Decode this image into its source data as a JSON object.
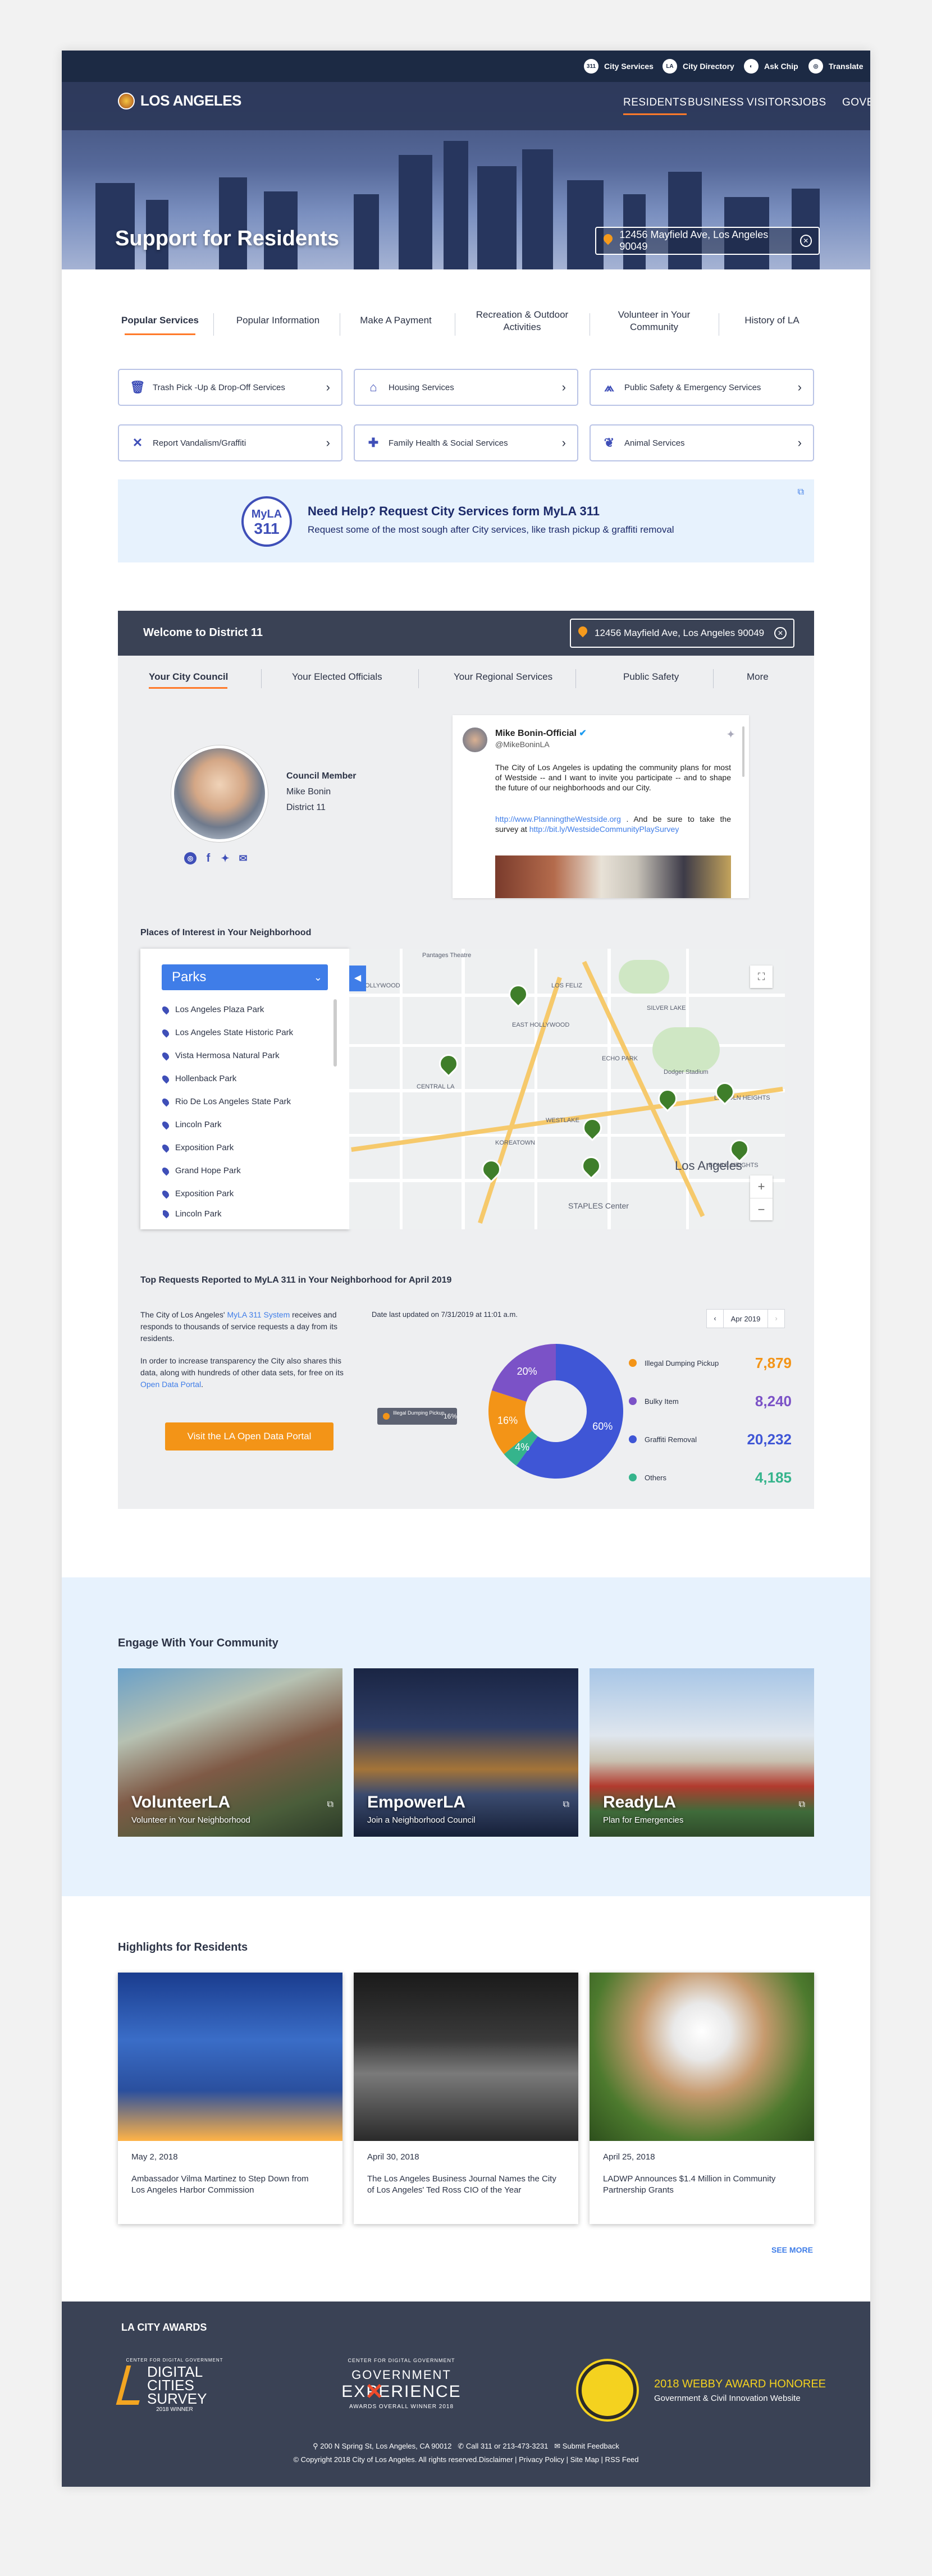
{
  "utility": {
    "items": [
      {
        "label": "City Services",
        "icon": "311"
      },
      {
        "label": "City Directory",
        "icon": "LA"
      },
      {
        "label": "Ask Chip",
        "icon": "chip"
      },
      {
        "label": "Translate",
        "icon": "globe"
      }
    ]
  },
  "brand": {
    "name": "LOS ANGELES"
  },
  "nav": {
    "items": [
      "RESIDENTS",
      "BUSINESS",
      "VISITORS",
      "JOBS",
      "GOVERNMENT"
    ],
    "active": "RESIDENTS"
  },
  "hero": {
    "title": "Support for Residents",
    "address": "12456 Mayfield Ave, Los Angeles 90049"
  },
  "tabs": [
    {
      "label": "Popular Services"
    },
    {
      "label": "Popular Information"
    },
    {
      "label": "Make A Payment"
    },
    {
      "label": "Recreation & Outdoor",
      "label2": "Activities"
    },
    {
      "label": "Volunteer in Your",
      "label2": "Community"
    },
    {
      "label": "History of LA"
    }
  ],
  "services": [
    {
      "label": "Trash Pick -Up & Drop-Off Services",
      "icon": "trash-icon"
    },
    {
      "label": "Housing Services",
      "icon": "house-icon"
    },
    {
      "label": "Public Safety & Emergency Services",
      "icon": "safety-icon"
    },
    {
      "label": "Report Vandalism/Graffiti",
      "icon": "x-icon"
    },
    {
      "label": "Family Health & Social Services",
      "icon": "cross-icon"
    },
    {
      "label": "Animal Services",
      "icon": "paw-icon"
    }
  ],
  "myla": {
    "logo_top": "MyLA",
    "logo_bottom": "311",
    "title": "Need Help? Request City Services form MyLA 311",
    "subtitle": "Request some of the most sough after City services, like trash pickup & graffiti removal"
  },
  "district": {
    "title": "Welcome to District 11",
    "address": "12456 Mayfield Ave, Los Angeles 90049",
    "tabs": [
      "Your City Council",
      "Your Elected Officials",
      "Your Regional Services",
      "Public Safety",
      "More"
    ],
    "member": {
      "role": "Council Member",
      "name": "Mike Bonin",
      "district": "District 11"
    },
    "tweet": {
      "name": "Mike Bonin-Official",
      "handle": "@MikeBoninLA",
      "text": "The City of Los Angeles is updating the community plans for most of Westside -- and I want to invite you participate -- and to shape the future of our neighborhoods and our City.",
      "link1": "http://www.PlanningtheWestside.org",
      "text2": ". And be sure to take the survey at",
      "link2": "http://bit.ly/WestsideCommunityPlaySurvey"
    }
  },
  "places": {
    "title": "Places of Interest in Your Neighborhood",
    "select": "Parks",
    "items": [
      "Los Angeles Plaza Park",
      "Los Angeles State Historic Park",
      "Vista Hermosa Natural Park",
      "Hollenback Park",
      "Rio De Los Angeles State Park",
      "Lincoln Park",
      "Exposition Park",
      "Grand Hope Park",
      "Exposition Park",
      "Lincoln Park"
    ],
    "map_labels": [
      "Pantages Theatre",
      "HOLLYWOOD",
      "SILVER LAKE",
      "ECHO PARK",
      "Dodger Stadium",
      "LINCOLN HEIGHTS",
      "BOYLE HEIGHTS",
      "KOREATOWN",
      "Los Angeles",
      "STAPLES Center",
      "WESTLAKE",
      "EAST HOLLYWOOD",
      "LOS FELIZ",
      "CENTRAL LA"
    ]
  },
  "requests": {
    "title": "Top Requests Reported to MyLA 311 in Your Neighborhood for April 2019",
    "para1_a": "The City of Los Angeles'",
    "para1_link": "MyLA 311 System",
    "para1_b": "receives and responds to thousands of service requests a day from its residents.",
    "para2_a": "In order to increase transparency the City also shares this data, along with hundreds of other data sets, for free on its",
    "para2_link": "Open Data Portal",
    "button": "Visit the LA Open Data Portal",
    "updated": "Date last updated on 7/31/2019 at 11:01 a.m.",
    "month": "Apr 2019",
    "tooltip": "Illegal Dumping Pickup",
    "tooltip_value": "16%"
  },
  "chart_data": {
    "type": "pie",
    "title": "",
    "categories": [
      "Illegal Dumping Pickup",
      "Bulky Item",
      "Graffiti Removal",
      "Others"
    ],
    "values": [
      16,
      20,
      60,
      4
    ],
    "counts": [
      7879,
      8240,
      20232,
      4185
    ],
    "count_labels": [
      "7,879",
      "8,240",
      "20,232",
      "4,185"
    ],
    "colors": [
      "#f39417",
      "#7b52c7",
      "#3f56d6",
      "#35b48c"
    ]
  },
  "engage": {
    "title": "Engage With Your Community",
    "cards": [
      {
        "title": "VolunteerLA",
        "subtitle": "Volunteer in Your Neighborhood"
      },
      {
        "title": "EmpowerLA",
        "subtitle": "Join a Neighborhood Council"
      },
      {
        "title": "ReadyLA",
        "subtitle": "Plan for Emergencies"
      }
    ]
  },
  "highlights": {
    "title": "Highlights for Residents",
    "items": [
      {
        "date": "May 2, 2018",
        "text": "Ambassador Vilma Martinez to Step Down from Los Angeles Harbor Commission"
      },
      {
        "date": "April 30, 2018",
        "text": "The Los Angeles Business Journal Names the City of Los Angeles' Ted Ross CIO of the Year"
      },
      {
        "date": "April 25, 2018",
        "text": "LADWP Announces $1.4 Million in Community Partnership Grants"
      }
    ],
    "see_more": "SEE MORE"
  },
  "footer": {
    "awards_title": "LA CITY AWARDS",
    "award1": {
      "top": "CENTER FOR DIGITAL GOVERNMENT",
      "line1": "DIGITAL",
      "line2": "CITIES",
      "line3": "SURVEY",
      "bottom": "2018 WINNER"
    },
    "award2": {
      "top": "CENTER FOR DIGITAL GOVERNMENT",
      "line1": "GOVERNMENT",
      "line2": "EXPERIENCE",
      "bottom": "AWARDS OVERALL WINNER 2018"
    },
    "award3": {
      "line1": "2018 WEBBY AWARD HONOREE",
      "line2": "Government & Civil Innovation Website"
    },
    "address": "200 N Spring St, Los Angeles, CA 90012",
    "phone": "Call 311 or 213-473-3231",
    "feedback": "Submit Feedback",
    "copyright": "© Copyright 2018 City of Los Angeles. All rights reserved.Disclaimer | Privacy Policy | Site Map | RSS Feed"
  }
}
